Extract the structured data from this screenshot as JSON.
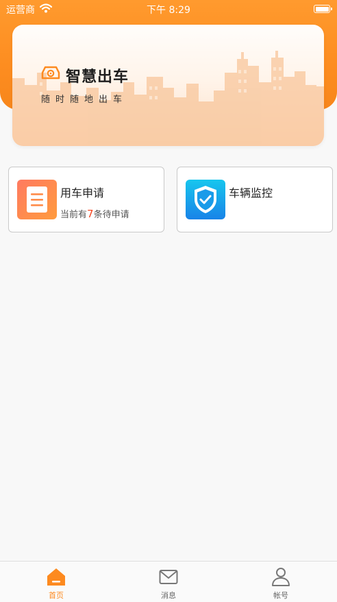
{
  "status_bar": {
    "carrier": "运营商",
    "time": "下午 8:29"
  },
  "banner": {
    "title": "智慧出车",
    "slogan": "随时随地出车"
  },
  "cards": {
    "apply": {
      "title": "用车申请",
      "sub_prefix": "当前有",
      "count": "7",
      "sub_suffix": "条待申请",
      "icon": "document-icon"
    },
    "monitor": {
      "title": "车辆监控",
      "icon": "shield-check-icon"
    }
  },
  "tabbar": {
    "items": [
      {
        "label": "首页",
        "icon": "home-icon",
        "active": true
      },
      {
        "label": "消息",
        "icon": "mail-icon",
        "active": false
      },
      {
        "label": "帐号",
        "icon": "user-icon",
        "active": false
      }
    ]
  },
  "colors": {
    "accent": "#fd8a1f",
    "highlight": "#f5441f",
    "monitor_blue": "#1883e8"
  }
}
